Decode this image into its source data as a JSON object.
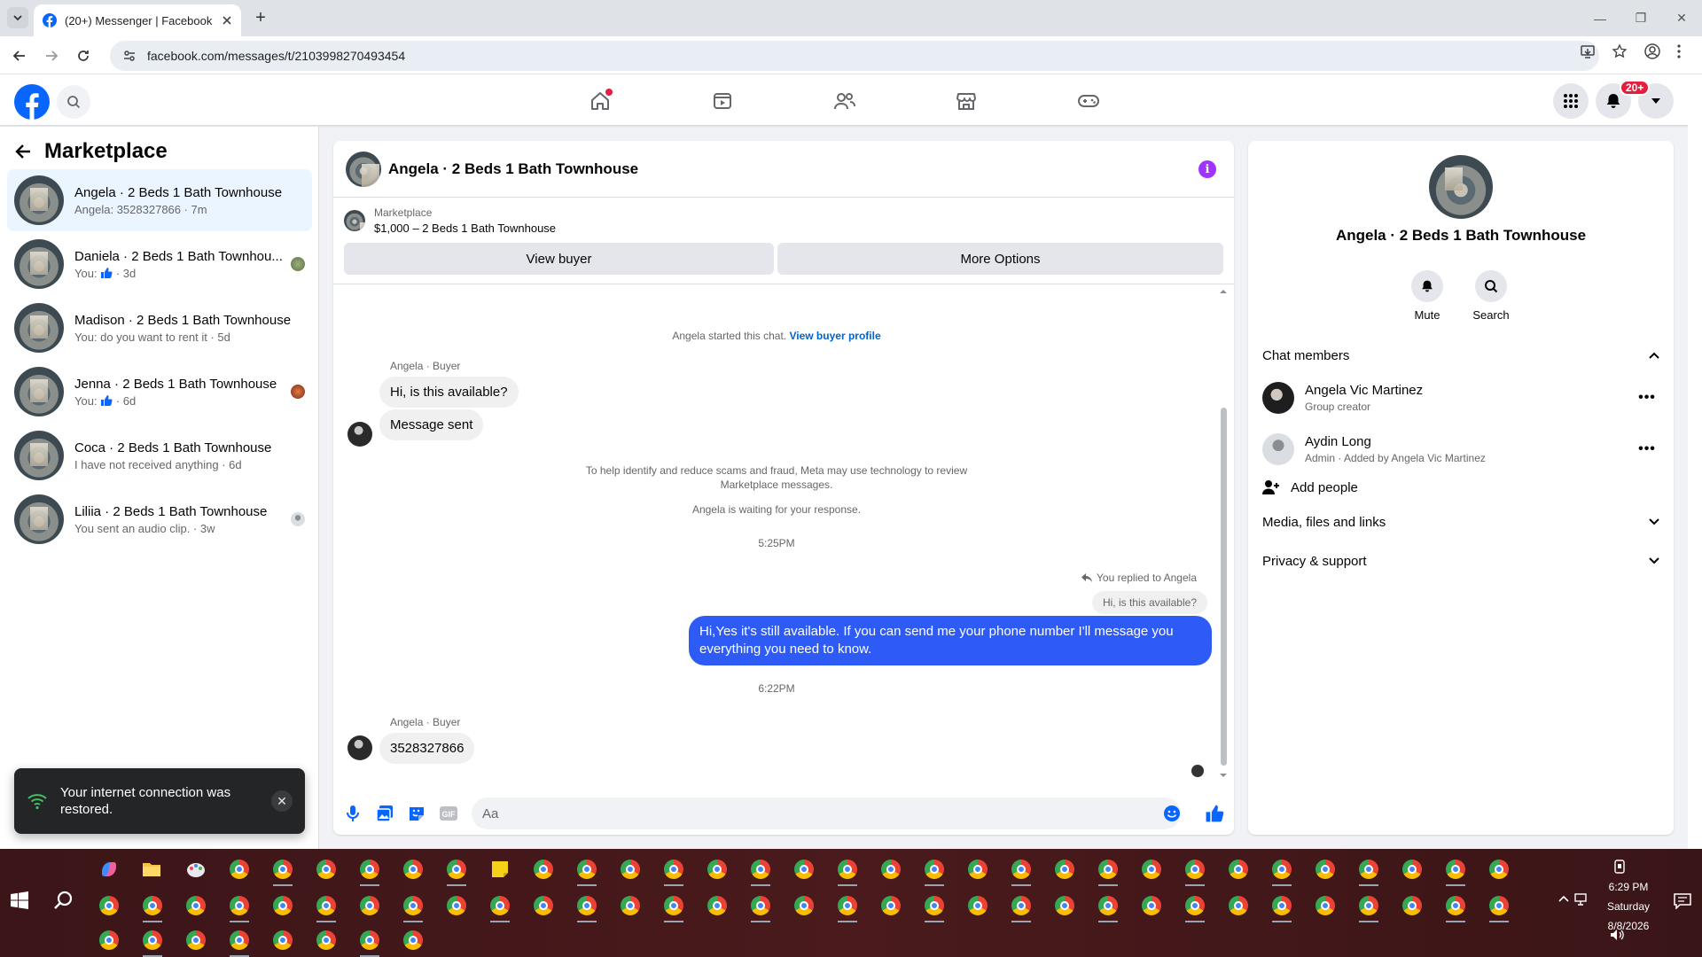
{
  "browser": {
    "tab_title": "(20+) Messenger | Facebook",
    "url": "facebook.com/messages/t/2103998270493454"
  },
  "header": {
    "notification_badge": "20+"
  },
  "left": {
    "title": "Marketplace",
    "conversations": [
      {
        "name": "Angela · 2 Beds 1 Bath Townhouse",
        "sub": "Angela: 3528327866 · 7m",
        "active": true
      },
      {
        "name": "Daniela · 2 Beds 1 Bath Townhou...",
        "sub_prefix": "You:",
        "sub_suffix": "· 3d"
      },
      {
        "name": "Madison · 2 Beds 1 Bath Townhouse",
        "sub": "You: do you want to rent it · 5d"
      },
      {
        "name": "Jenna · 2 Beds 1 Bath Townhouse",
        "sub_prefix": "You:",
        "sub_suffix": "· 6d"
      },
      {
        "name": "Coca · 2 Beds 1 Bath Townhouse",
        "sub": "I have not received anything · 6d"
      },
      {
        "name": "Liliia · 2 Beds 1 Bath Townhouse",
        "sub": "You sent an audio clip. · 3w"
      }
    ]
  },
  "toast": {
    "message": "Your internet connection was restored."
  },
  "chat": {
    "title": "Angela · 2 Beds 1 Bath Townhouse",
    "marketplace_label": "Marketplace",
    "listing": "$1,000 – 2 Beds 1 Bath Townhouse",
    "view_buyer": "View buyer",
    "more_options": "More Options",
    "started": "Angela started this chat.",
    "view_profile": "View buyer profile",
    "sender_label": "Angela · Buyer",
    "msg1": "Hi, is this available?",
    "msg2": "Message sent",
    "disclaimer_line1": "To help identify and reduce scams and fraud, Meta may use technology to review",
    "disclaimer_line2": "Marketplace messages.",
    "waiting": "Angela is waiting for your response.",
    "time1": "5:25PM",
    "replied": "You replied to Angela",
    "quoted": "Hi, is this available?",
    "reply": "Hi,Yes it's still available. If you can send me your phone number I'll message you everything you need to know.",
    "time2": "6:22PM",
    "sender_label2": "Angela · Buyer",
    "msg3": "3528327866",
    "input_placeholder": "Aa"
  },
  "info": {
    "title": "Angela · 2 Beds 1 Bath Townhouse",
    "mute": "Mute",
    "search": "Search",
    "chat_members": "Chat members",
    "members": [
      {
        "name": "Angela Vic Martinez",
        "role": "Group creator"
      },
      {
        "name": "Aydin Long",
        "role": "Admin · Added by Angela Vic Martinez"
      }
    ],
    "add_people": "Add people",
    "media": "Media, files and links",
    "privacy": "Privacy & support"
  },
  "taskbar": {
    "time": "6:29 PM",
    "day": "Saturday",
    "date": "8/8/2026"
  },
  "colors": {
    "fb_blue": "#0866ff",
    "outgoing_bubble": "#2e5bf5",
    "active_conv": "#ebf5ff",
    "badge_red": "#e41e3f"
  }
}
